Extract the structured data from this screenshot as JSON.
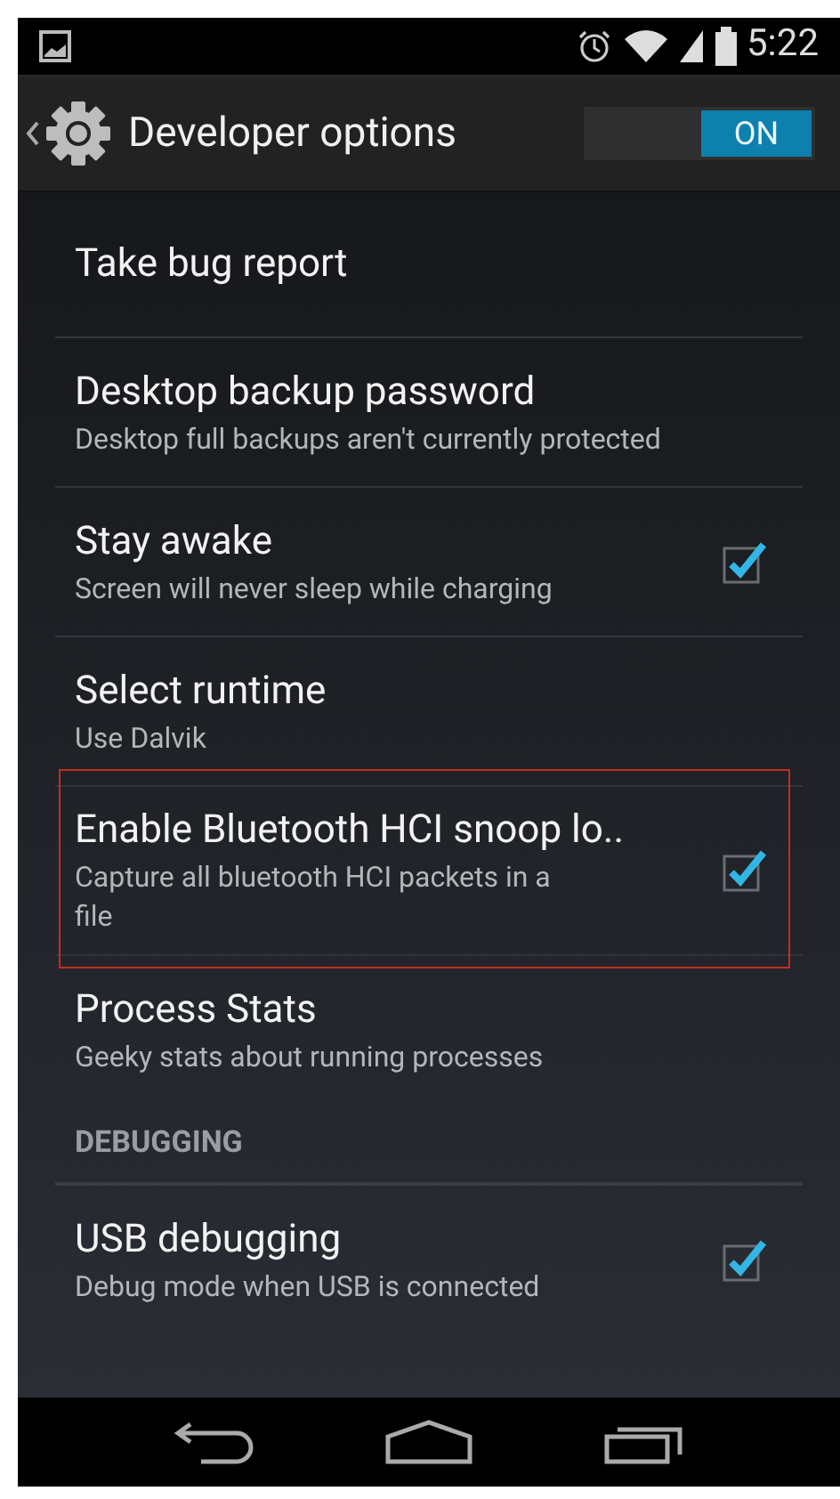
{
  "status_bar": {
    "time": "5:22"
  },
  "action_bar": {
    "title": "Developer options",
    "switch": {
      "label": "ON",
      "on": true
    }
  },
  "settings": [
    {
      "kind": "item",
      "title": "Take bug report"
    },
    {
      "kind": "item",
      "title": "Desktop backup password",
      "summary": "Desktop full backups aren't currently protected"
    },
    {
      "kind": "checkbox",
      "title": "Stay awake",
      "summary": "Screen will never sleep while charging",
      "checked": true
    },
    {
      "kind": "item",
      "title": "Select runtime",
      "summary": "Use Dalvik"
    },
    {
      "kind": "checkbox",
      "title": "Enable Bluetooth HCI snoop lo..",
      "summary": "Capture all bluetooth HCI packets in a file",
      "checked": true,
      "highlighted": true
    },
    {
      "kind": "item",
      "title": "Process Stats",
      "summary": "Geeky stats about running processes"
    },
    {
      "kind": "header",
      "title": "DEBUGGING"
    },
    {
      "kind": "checkbox",
      "title": "USB debugging",
      "summary": "Debug mode when USB is connected",
      "checked": true
    }
  ]
}
